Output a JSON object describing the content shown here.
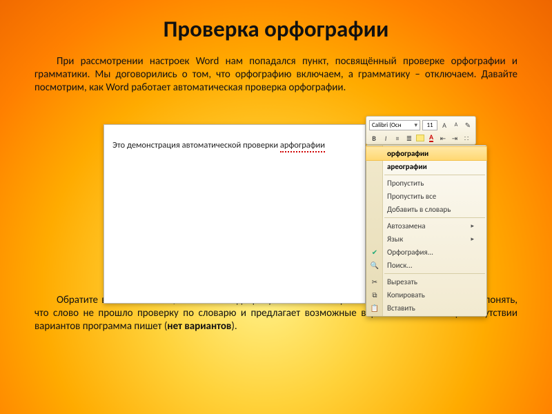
{
  "title": "Проверка орфографии",
  "para1": "При рассмотрении настроек Word нам попадался пункт, посвящённый проверке орфографии и грамматики.  Мы договорились о том, что орфографию включаем, а грамматику – отключаем. Давайте посмотрим, как Word работает автоматическая проверка орфографии.",
  "para2_a": "Обратите внимание на то, что слово подчёркнуто волнистой красной чертой, – т.о. Wordдаёт понять, что слово не прошло проверку по словарю и предлагает возможные варианты замены. При отсутствии вариантов программа пишет (",
  "para2_bold": "нет вариантов",
  "para2_b": ").",
  "word": {
    "text_prefix": "Это демонстрация автоматической проверки ",
    "misspelled": "арфографии",
    "toolbar": {
      "font_name": "Calibri (Осн",
      "font_size": "11",
      "bold": "B",
      "italic": "I",
      "grow": "A",
      "shrink": "A"
    },
    "menu": {
      "suggestions": [
        "орфографии",
        "ареографии"
      ],
      "skip": "Пропустить",
      "skip_all": "Пропустить все",
      "add_dict": "Добавить в словарь",
      "autocorrect": "Автозамена",
      "language": "Язык",
      "spelling": "Орфография...",
      "search": "Поиск...",
      "cut": "Вырезать",
      "copy": "Копировать",
      "paste": "Вставить"
    }
  }
}
